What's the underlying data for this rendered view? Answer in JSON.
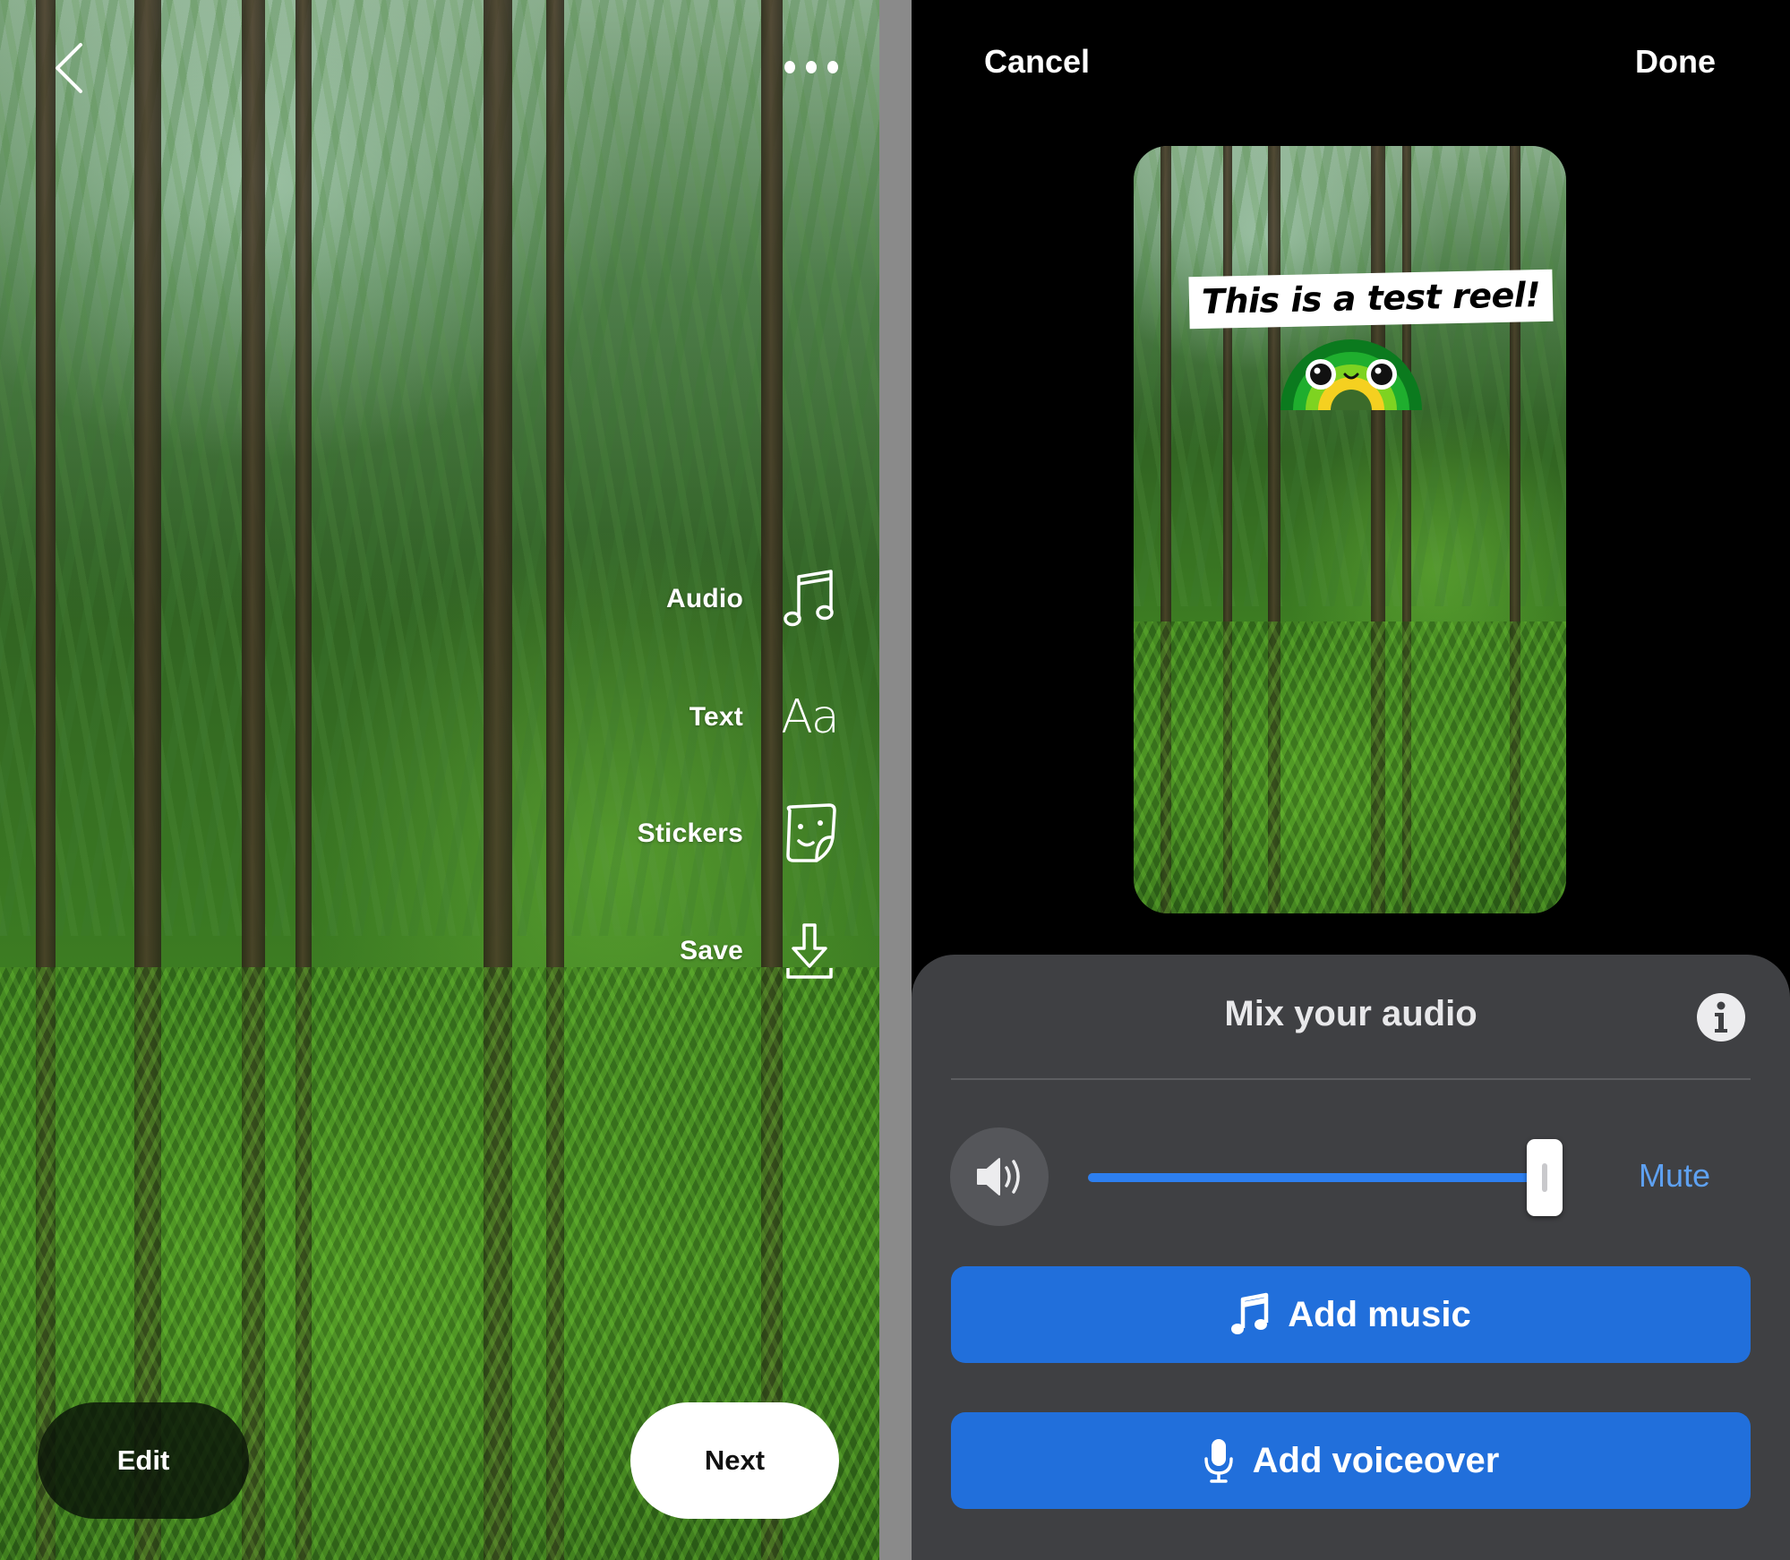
{
  "left_panel": {
    "back_icon": "chevron-left-icon",
    "more_icon": "more-horizontal-icon",
    "tools": [
      {
        "label": "Audio",
        "icon": "music-note-icon"
      },
      {
        "label": "Text",
        "icon": "text-aa-icon"
      },
      {
        "label": "Stickers",
        "icon": "sticker-icon"
      },
      {
        "label": "Save",
        "icon": "download-icon"
      }
    ],
    "text_icon_glyph": "Aa",
    "edit_label": "Edit",
    "next_label": "Next"
  },
  "right_panel": {
    "cancel_label": "Cancel",
    "done_label": "Done",
    "preview": {
      "caption": "This is a test reel!",
      "sticker": "rainbow-face-sticker"
    },
    "sheet": {
      "title": "Mix your audio",
      "info_icon": "info-icon",
      "volume": {
        "icon": "speaker-icon",
        "level_percent": 100,
        "mute_label": "Mute"
      },
      "buttons": [
        {
          "label": "Add music",
          "icon": "music-note-icon"
        },
        {
          "label": "Add voiceover",
          "icon": "microphone-icon"
        }
      ]
    }
  },
  "colors": {
    "accent_blue": "#216fdb",
    "slider_blue": "#2d7ff0",
    "mute_blue": "#5ea1f2",
    "sheet_bg": "#3f4043"
  }
}
